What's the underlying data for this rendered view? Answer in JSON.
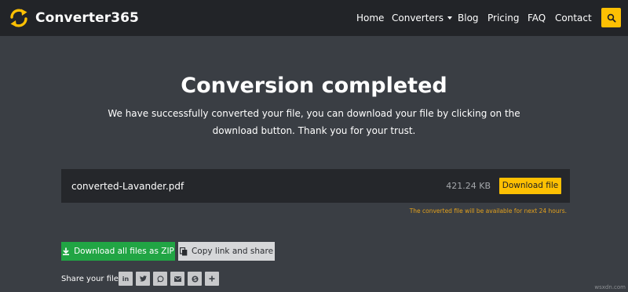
{
  "brand": {
    "name": "Converter365"
  },
  "nav": {
    "home": "Home",
    "converters": "Converters",
    "blog": "Blog",
    "pricing": "Pricing",
    "faq": "FAQ",
    "contact": "Contact",
    "search_icon": "search-icon"
  },
  "hero": {
    "title": "Conversion completed",
    "description": "We have successfully converted your file, you can download your file by clicking on the download button. Thank you for your trust."
  },
  "file": {
    "name": "converted-Lavander.pdf",
    "size": "421.24 KB",
    "download_label": "Download file",
    "availability_note": "The converted file will be available for next 24 hours."
  },
  "actions": {
    "zip_label": "Download all files as ZIP",
    "copy_label": "Copy link and share"
  },
  "share": {
    "label": "Share your file",
    "icons": [
      "linkedin-icon",
      "twitter-icon",
      "whatsapp-icon",
      "email-icon",
      "skype-icon",
      "more-icon"
    ]
  },
  "watermark": "wsxdn.com",
  "colors": {
    "background": "#3a3e44",
    "navbar": "#222428",
    "accent": "#fdc003",
    "file_row": "#25272b",
    "zip_button": "#21a544",
    "copy_button": "#d6d7d9",
    "note": "#e3a11d"
  }
}
